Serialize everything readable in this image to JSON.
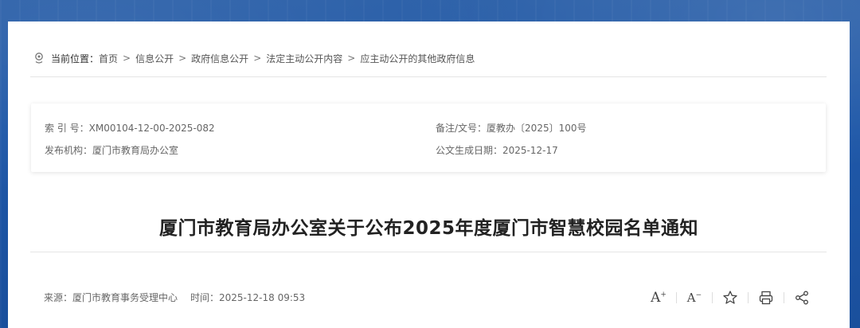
{
  "breadcrumb": {
    "label": "当前位置：",
    "items": [
      "首页",
      "信息公开",
      "政府信息公开",
      "法定主动公开内容",
      "应主动公开的其他政府信息"
    ],
    "separator": ">"
  },
  "meta": {
    "index_no": "索 引 号：XM00104-12-00-2025-082",
    "publisher": "发布机构：厦门市教育局办公室",
    "doc_no": "备注/文号：厦教办〔2025〕100号",
    "doc_date": "公文生成日期：2025-12-17"
  },
  "article": {
    "title": "厦门市教育局办公室关于公布2025年度厦门市智慧校园名单通知",
    "source": "来源：厦门市教育事务受理中心",
    "time": "时间：2025-12-18 09:53"
  },
  "tools": {
    "font_increase": "A+",
    "font_decrease": "A−"
  }
}
